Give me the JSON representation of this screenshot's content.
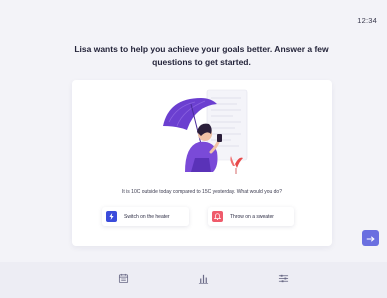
{
  "status_bar": {
    "time": "12:34"
  },
  "onboarding": {
    "headline_line1": "Lisa wants to help you achieve your goals better. Answer a few",
    "headline_line2": "questions to get started.",
    "question": "It is 10C outside today compared to 15C yesterday. What would you do?",
    "choices": [
      {
        "label": "Switch on the heater",
        "icon": "lightning-icon",
        "color": "#3b4cdb"
      },
      {
        "label": "Throw on a sweater",
        "icon": "bell-icon",
        "color": "#ef5b6b"
      }
    ],
    "next_icon": "arrow-right-icon"
  },
  "bottom_nav": {
    "items": [
      {
        "icon": "calendar-icon"
      },
      {
        "icon": "bar-chart-icon"
      },
      {
        "icon": "sliders-icon"
      }
    ]
  },
  "colors": {
    "accent": "#6a6fe0",
    "illustration_purple": "#6b3fd0",
    "background": "#f3f3f8"
  }
}
